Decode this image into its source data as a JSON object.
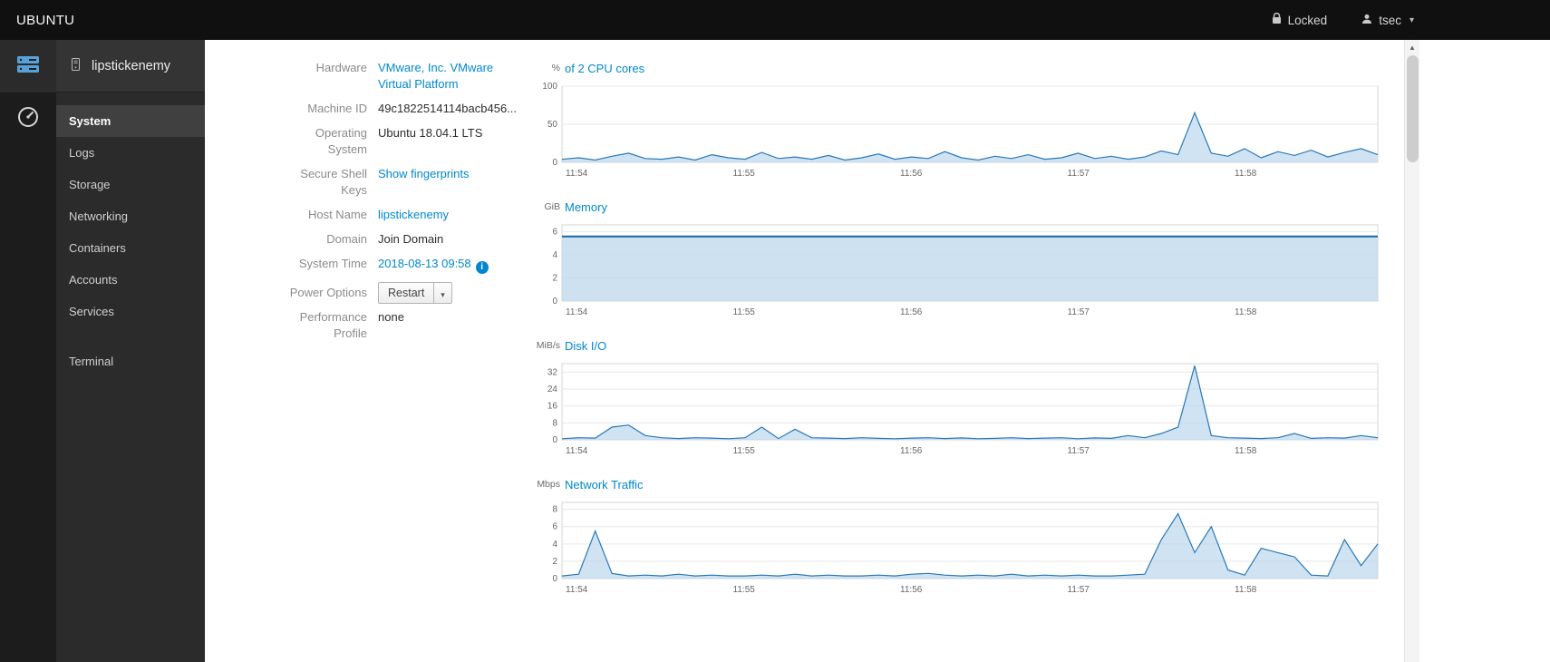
{
  "colors": {
    "link": "#0088ce",
    "chart_line": "#2878b8",
    "chart_fill": "#bcd7ec",
    "topbar_bg": "#101010",
    "sidebar_bg": "#2b2b2b"
  },
  "topbar": {
    "brand": "UBUNTU",
    "locked_label": "Locked",
    "user_label": "tsec"
  },
  "sidebar": {
    "host": "lipstickenemy",
    "items": [
      {
        "label": "System",
        "active": true
      },
      {
        "label": "Logs"
      },
      {
        "label": "Storage"
      },
      {
        "label": "Networking"
      },
      {
        "label": "Containers"
      },
      {
        "label": "Accounts"
      },
      {
        "label": "Services"
      },
      {
        "label": "Terminal",
        "separated": true
      }
    ]
  },
  "details": {
    "hardware": {
      "label": "Hardware",
      "value": "VMware, Inc. VMware Virtual Platform"
    },
    "machine_id": {
      "label": "Machine ID",
      "value": "49c1822514114bacb456..."
    },
    "os": {
      "label": "Operating System",
      "value": "Ubuntu 18.04.1 LTS"
    },
    "ssh_keys": {
      "label": "Secure Shell Keys",
      "value": "Show fingerprints"
    },
    "hostname": {
      "label": "Host Name",
      "value": "lipstickenemy"
    },
    "domain": {
      "label": "Domain",
      "value": "Join Domain"
    },
    "system_time": {
      "label": "System Time",
      "value": "2018-08-13 09:58"
    },
    "power_options": {
      "label": "Power Options",
      "button": "Restart"
    },
    "performance_profile": {
      "label": "Performance Profile",
      "value": "none"
    }
  },
  "chart_data": [
    {
      "type": "area",
      "id": "cpu",
      "unit": "%",
      "title": "of 2 CPU cores",
      "ylim": [
        0,
        100
      ],
      "yticks": [
        0,
        50,
        100
      ],
      "line_width": 1.2,
      "xticks": [
        {
          "f": 0.018,
          "label": "11:54"
        },
        {
          "f": 0.223,
          "label": "11:55"
        },
        {
          "f": 0.428,
          "label": "11:56"
        },
        {
          "f": 0.633,
          "label": "11:57"
        },
        {
          "f": 0.838,
          "label": "11:58"
        }
      ],
      "values": [
        4,
        6,
        3,
        8,
        12,
        5,
        4,
        7,
        3,
        10,
        6,
        4,
        13,
        5,
        7,
        4,
        9,
        3,
        6,
        11,
        4,
        7,
        5,
        14,
        6,
        3,
        8,
        5,
        10,
        4,
        6,
        12,
        5,
        8,
        4,
        7,
        15,
        10,
        65,
        12,
        8,
        18,
        6,
        14,
        9,
        16,
        7,
        13,
        18,
        10
      ]
    },
    {
      "type": "area",
      "id": "memory",
      "unit": "GiB",
      "title": "Memory",
      "ylim": [
        0,
        6.6
      ],
      "yticks": [
        0,
        2,
        4,
        6
      ],
      "line_width": 2,
      "line_color": "#1d64a5",
      "fill_opacity": 0.75,
      "xticks": [
        {
          "f": 0.018,
          "label": "11:54"
        },
        {
          "f": 0.223,
          "label": "11:55"
        },
        {
          "f": 0.428,
          "label": "11:56"
        },
        {
          "f": 0.633,
          "label": "11:57"
        },
        {
          "f": 0.838,
          "label": "11:58"
        }
      ],
      "values": [
        5.6,
        5.6,
        5.6,
        5.6,
        5.6,
        5.6,
        5.6,
        5.6,
        5.6,
        5.6
      ]
    },
    {
      "type": "area",
      "id": "disk",
      "unit": "MiB/s",
      "title": "Disk I/O",
      "ylim": [
        0,
        36
      ],
      "yticks": [
        0,
        8,
        16,
        24,
        32
      ],
      "line_width": 1.2,
      "xticks": [
        {
          "f": 0.018,
          "label": "11:54"
        },
        {
          "f": 0.223,
          "label": "11:55"
        },
        {
          "f": 0.428,
          "label": "11:56"
        },
        {
          "f": 0.633,
          "label": "11:57"
        },
        {
          "f": 0.838,
          "label": "11:58"
        }
      ],
      "values": [
        0.5,
        1,
        0.8,
        6,
        7,
        2,
        1,
        0.6,
        1,
        0.8,
        0.5,
        1,
        6,
        0.6,
        5,
        1,
        0.8,
        0.6,
        1,
        0.7,
        0.5,
        0.8,
        1,
        0.6,
        0.9,
        0.5,
        0.7,
        1,
        0.6,
        0.8,
        1,
        0.5,
        0.9,
        0.7,
        2,
        1,
        3,
        6,
        35,
        2,
        1,
        0.8,
        0.6,
        1,
        3,
        0.7,
        1,
        0.8,
        2,
        1
      ]
    },
    {
      "type": "area",
      "id": "network",
      "unit": "Mbps",
      "title": "Network Traffic",
      "ylim": [
        0,
        8.8
      ],
      "yticks": [
        0,
        2,
        4,
        6,
        8
      ],
      "line_width": 1.2,
      "xticks": [
        {
          "f": 0.018,
          "label": "11:54"
        },
        {
          "f": 0.223,
          "label": "11:55"
        },
        {
          "f": 0.428,
          "label": "11:56"
        },
        {
          "f": 0.633,
          "label": "11:57"
        },
        {
          "f": 0.838,
          "label": "11:58"
        }
      ],
      "values": [
        0.3,
        0.5,
        5.5,
        0.6,
        0.3,
        0.4,
        0.3,
        0.5,
        0.3,
        0.4,
        0.3,
        0.3,
        0.4,
        0.3,
        0.5,
        0.3,
        0.4,
        0.3,
        0.3,
        0.4,
        0.3,
        0.5,
        0.6,
        0.4,
        0.3,
        0.4,
        0.3,
        0.5,
        0.3,
        0.4,
        0.3,
        0.4,
        0.3,
        0.3,
        0.4,
        0.5,
        4.5,
        7.5,
        3,
        6,
        1,
        0.4,
        3.5,
        3,
        2.5,
        0.4,
        0.3,
        4.5,
        1.5,
        4
      ]
    }
  ]
}
